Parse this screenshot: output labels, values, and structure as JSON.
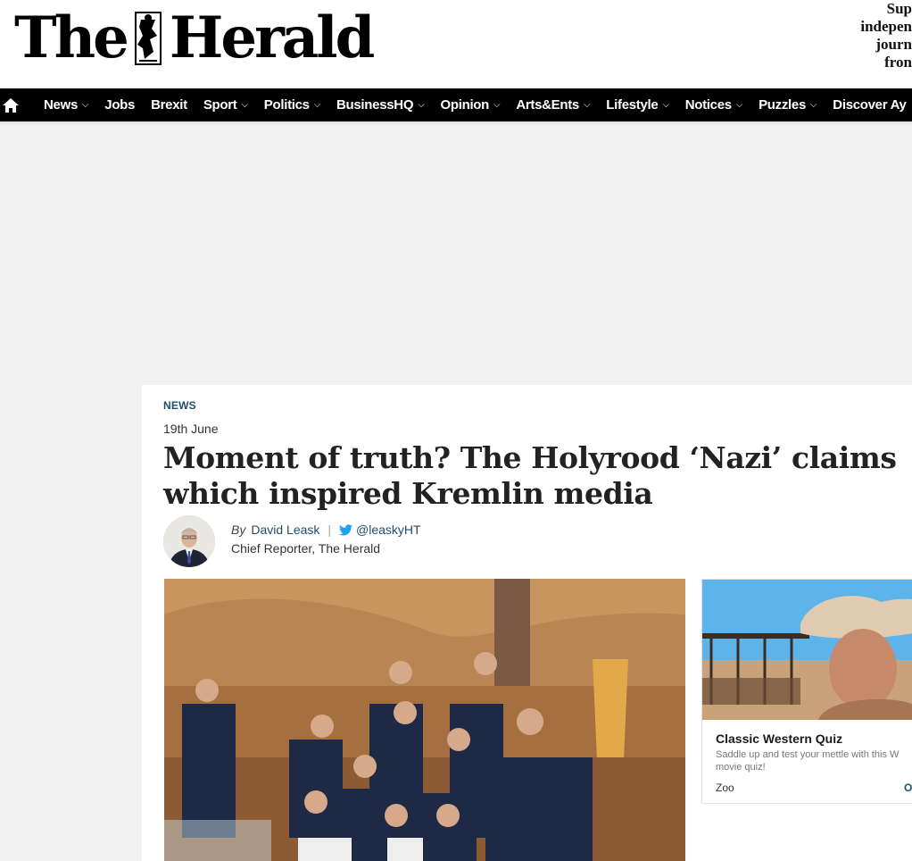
{
  "brand": {
    "logo_left": "The",
    "logo_right": "Herald",
    "support_lines": [
      "Sup",
      "indepen",
      "journ",
      "fron"
    ]
  },
  "nav": {
    "home_icon": "home-icon",
    "items": [
      {
        "label": "News",
        "has_dropdown": true
      },
      {
        "label": "Jobs",
        "has_dropdown": false
      },
      {
        "label": "Brexit",
        "has_dropdown": false
      },
      {
        "label": "Sport",
        "has_dropdown": true
      },
      {
        "label": "Politics",
        "has_dropdown": true
      },
      {
        "label": "BusinessHQ",
        "has_dropdown": true
      },
      {
        "label": "Opinion",
        "has_dropdown": true
      },
      {
        "label": "Arts&Ents",
        "has_dropdown": true
      },
      {
        "label": "Lifestyle",
        "has_dropdown": true
      },
      {
        "label": "Notices",
        "has_dropdown": true
      },
      {
        "label": "Puzzles",
        "has_dropdown": true
      },
      {
        "label": "Discover Ay",
        "has_dropdown": false
      }
    ]
  },
  "article": {
    "section": "NEWS",
    "date": "19th June",
    "headline": "Moment of truth? The Holyrood ‘Nazi’ claims which inspired Kremlin media",
    "byline": {
      "by": "By",
      "author": "David Leask",
      "twitter": "@leaskyHT",
      "role": "Chief Reporter, The Herald"
    }
  },
  "promo": {
    "title": "Classic Western Quiz",
    "description": "Saddle up and test your mettle with this W movie quiz!",
    "source": "Zoo",
    "cta": "O"
  },
  "colors": {
    "nav_bg": "#000000",
    "accent": "#1f4d6e",
    "page_bg": "#f2f2f2"
  }
}
